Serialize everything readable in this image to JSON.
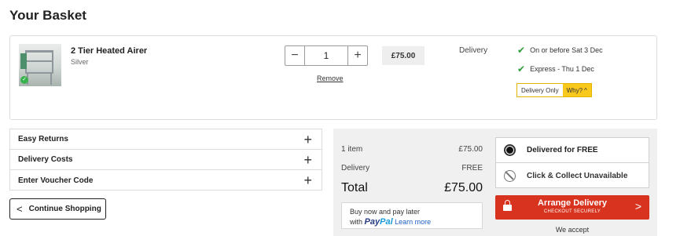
{
  "page": {
    "title": "Your Basket"
  },
  "basket_item": {
    "name": "2 Tier Heated Airer",
    "variant": "Silver",
    "quantity": "1",
    "remove_label": "Remove",
    "price": "£75.00",
    "delivery_label": "Delivery",
    "delivery_options": [
      {
        "text": "On or before Sat 3 Dec",
        "icon": "check-icon"
      },
      {
        "text": "Express - Thu 1 Dec",
        "icon": "check-icon"
      }
    ],
    "delivery_only": {
      "text": "Delivery Only",
      "why_label": "Why?"
    }
  },
  "accordion": {
    "items": [
      {
        "label": "Easy Returns"
      },
      {
        "label": "Delivery Costs"
      },
      {
        "label": "Enter Voucher Code"
      }
    ]
  },
  "continue_button": {
    "label": "Continue Shopping"
  },
  "summary": {
    "items_label": "1 item",
    "items_value": "£75.00",
    "delivery_label": "Delivery",
    "delivery_value": "FREE",
    "total_label": "Total",
    "total_value": "£75.00",
    "paypal": {
      "line1": "Buy now and pay later",
      "with": "with",
      "brand_pay": "Pay",
      "brand_pal": "Pal",
      "learn_more": "Learn more"
    }
  },
  "shipping_options": [
    {
      "label": "Delivered for FREE",
      "selected": true
    },
    {
      "label": "Click & Collect Unavailable",
      "selected": false
    }
  ],
  "arrange_button": {
    "label": "Arrange Delivery",
    "sublabel": "CHECKOUT SECURELY"
  },
  "we_accept": "We accept",
  "colors": {
    "accent_red": "#d7331e",
    "check_green": "#2e9e3a",
    "why_yellow": "#f8c81c",
    "paypal_dark": "#253b80",
    "paypal_light": "#179bd7"
  }
}
